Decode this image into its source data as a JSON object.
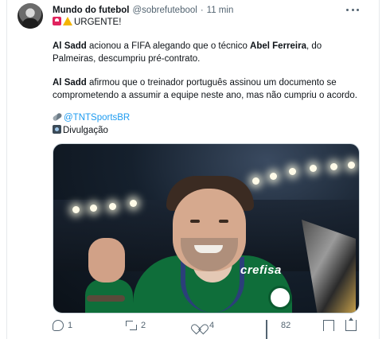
{
  "tweet": {
    "author_name": "Mundo do futebol",
    "author_handle": "@sobrefutebool",
    "separator": "·",
    "time": "11 min",
    "line1": "URGENTE!",
    "p1": {
      "a": "Al Sadd",
      "b": " acionou a FIFA alegando que o técnico ",
      "c": "Abel Ferreira",
      "d": ", do",
      "line2": "Palmeiras, descumpriu pré-contrato."
    },
    "p2": {
      "a": "Al Sadd",
      "b": " afirmou que o treinador português assinou um documento se",
      "line2": "comprometendo a assumir a equipe neste ano, mas não cumpriu o acordo."
    },
    "credit_link": "@TNTSportsBR",
    "credit_photo": "Divulgação",
    "media": {
      "sponsor_text": "crefisa"
    },
    "icons": {
      "siren": "rotating-light-icon",
      "warning": "warning-icon",
      "clip": "paperclip-icon",
      "camera": "camera-icon"
    }
  },
  "actions": {
    "replies": "1",
    "retweets": "2",
    "likes": "4",
    "views": "82"
  }
}
